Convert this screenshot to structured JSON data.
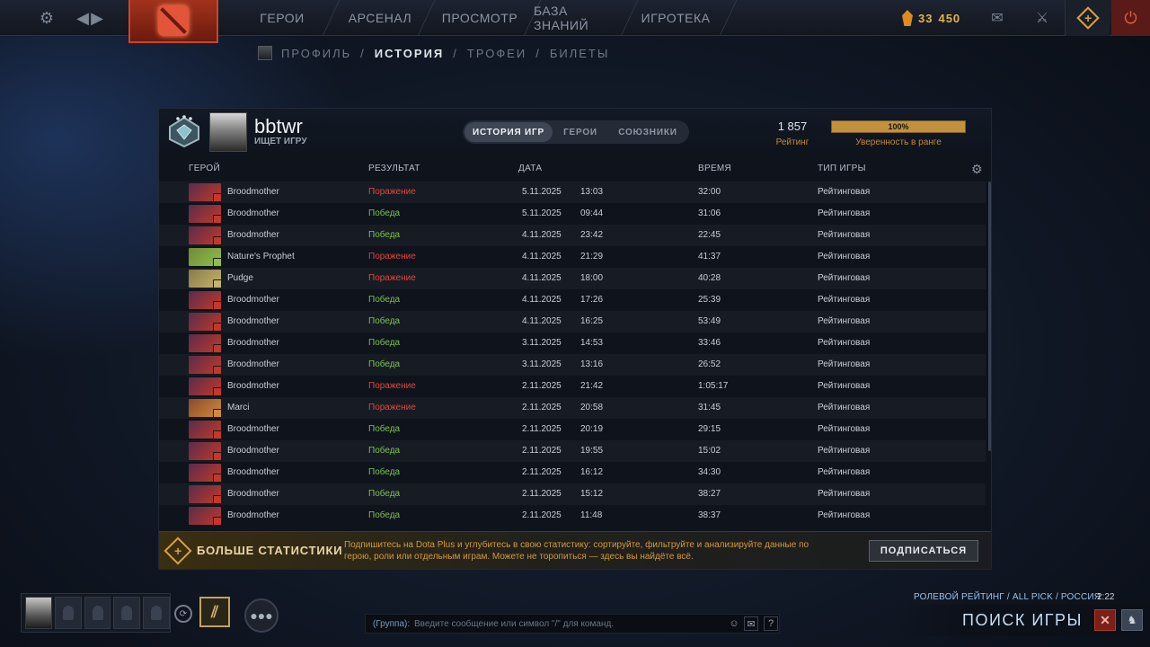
{
  "top_nav": {
    "items": [
      "ГЕРОИ",
      "АРСЕНАЛ",
      "ПРОСМОТР",
      "БАЗА ЗНАНИЙ",
      "ИГРОТЕКА"
    ],
    "shards_thousands": "33",
    "shards_units": "450"
  },
  "sub_nav": {
    "items": [
      "ПРОФИЛЬ",
      "ИСТОРИЯ",
      "ТРОФЕИ",
      "БИЛЕТЫ"
    ],
    "separator": "/"
  },
  "profile": {
    "name": "bbtwr",
    "status": "ИЩЕТ ИГРУ",
    "rating": "1 857",
    "rating_label": "Рейтинг",
    "confidence_value": "100%",
    "confidence_fraction": 1.0,
    "confidence_label": "Уверенность в ранге",
    "tabs": [
      "ИСТОРИЯ ИГР",
      "ГЕРОИ",
      "СОЮЗНИКИ"
    ]
  },
  "table": {
    "headers": {
      "hero": "ГЕРОЙ",
      "result": "РЕЗУЛЬТАТ",
      "date": "ДАТА",
      "duration": "ВРЕМЯ",
      "type": "ТИП ИГРЫ"
    },
    "rows": [
      {
        "hero": "Broodmother",
        "result": "Поражение",
        "win": false,
        "date": "5.11.2025",
        "time": "13:03",
        "duration": "32:00",
        "type": "Рейтинговая"
      },
      {
        "hero": "Broodmother",
        "result": "Победа",
        "win": true,
        "date": "5.11.2025",
        "time": "09:44",
        "duration": "31:06",
        "type": "Рейтинговая"
      },
      {
        "hero": "Broodmother",
        "result": "Победа",
        "win": true,
        "date": "4.11.2025",
        "time": "23:42",
        "duration": "22:45",
        "type": "Рейтинговая"
      },
      {
        "hero": "Nature's Prophet",
        "result": "Поражение",
        "win": false,
        "date": "4.11.2025",
        "time": "21:29",
        "duration": "41:37",
        "type": "Рейтинговая"
      },
      {
        "hero": "Pudge",
        "result": "Поражение",
        "win": false,
        "date": "4.11.2025",
        "time": "18:00",
        "duration": "40:28",
        "type": "Рейтинговая"
      },
      {
        "hero": "Broodmother",
        "result": "Победа",
        "win": true,
        "date": "4.11.2025",
        "time": "17:26",
        "duration": "25:39",
        "type": "Рейтинговая"
      },
      {
        "hero": "Broodmother",
        "result": "Победа",
        "win": true,
        "date": "4.11.2025",
        "time": "16:25",
        "duration": "53:49",
        "type": "Рейтинговая"
      },
      {
        "hero": "Broodmother",
        "result": "Победа",
        "win": true,
        "date": "3.11.2025",
        "time": "14:53",
        "duration": "33:46",
        "type": "Рейтинговая"
      },
      {
        "hero": "Broodmother",
        "result": "Победа",
        "win": true,
        "date": "3.11.2025",
        "time": "13:16",
        "duration": "26:52",
        "type": "Рейтинговая"
      },
      {
        "hero": "Broodmother",
        "result": "Поражение",
        "win": false,
        "date": "2.11.2025",
        "time": "21:42",
        "duration": "1:05:17",
        "type": "Рейтинговая"
      },
      {
        "hero": "Marci",
        "result": "Поражение",
        "win": false,
        "date": "2.11.2025",
        "time": "20:58",
        "duration": "31:45",
        "type": "Рейтинговая"
      },
      {
        "hero": "Broodmother",
        "result": "Победа",
        "win": true,
        "date": "2.11.2025",
        "time": "20:19",
        "duration": "29:15",
        "type": "Рейтинговая"
      },
      {
        "hero": "Broodmother",
        "result": "Победа",
        "win": true,
        "date": "2.11.2025",
        "time": "19:55",
        "duration": "15:02",
        "type": "Рейтинговая"
      },
      {
        "hero": "Broodmother",
        "result": "Победа",
        "win": true,
        "date": "2.11.2025",
        "time": "16:12",
        "duration": "34:30",
        "type": "Рейтинговая"
      },
      {
        "hero": "Broodmother",
        "result": "Победа",
        "win": true,
        "date": "2.11.2025",
        "time": "15:12",
        "duration": "38:27",
        "type": "Рейтинговая"
      },
      {
        "hero": "Broodmother",
        "result": "Победа",
        "win": true,
        "date": "2.11.2025",
        "time": "11:48",
        "duration": "38:37",
        "type": "Рейтинговая"
      }
    ]
  },
  "hero_colors": {
    "Broodmother": [
      "#5a2c4a",
      "#c0392b"
    ],
    "Nature's Prophet": [
      "#6f8a3a",
      "#8fbf4a"
    ],
    "Pudge": [
      "#8a7a4a",
      "#c7b36a"
    ],
    "Marci": [
      "#8a4a2a",
      "#d08a3a"
    ]
  },
  "dota_plus": {
    "title": "БОЛЬШЕ СТАТИСТИКИ",
    "text": "Подпишитесь на Dota Plus и углубитесь в свою статистику: сортируйте, фильтруйте и анализируйте данные по герою, роли или отдельным играм. Можете не торопиться — здесь вы найдёте всё.",
    "button": "ПОДПИСАТЬСЯ"
  },
  "chat": {
    "label": "(Группа):",
    "placeholder": "Введите сообщение или символ \"/\" для команд."
  },
  "queue": {
    "info": "РОЛЕВОЙ РЕЙТИНГ / ALL PICK / РОССИЯ",
    "time": "2:22",
    "status": "ПОИСК ИГРЫ"
  },
  "colors": {
    "win": "#7cc24e",
    "loss": "#e2463d",
    "accent_gold": "#d8a33c"
  }
}
